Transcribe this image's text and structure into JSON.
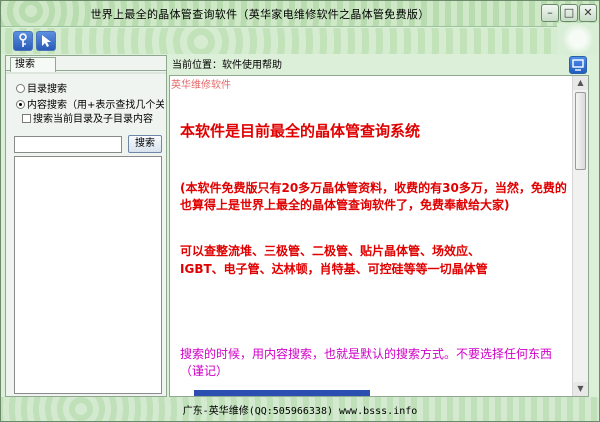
{
  "window": {
    "title": "世界上最全的晶体管查询软件（英华家电维修软件之晶体管免费版）"
  },
  "caption_buttons": {
    "minimize": "–",
    "maximize": "□",
    "close": "✕"
  },
  "toolbar": {
    "icons": [
      "key-icon",
      "arrow-cursor-icon"
    ]
  },
  "left_panel": {
    "tab_label": "搜索",
    "options": {
      "dir_search": "目录搜索",
      "content_search": "内容搜索（用+表示查找几个关键",
      "search_subdirs": "搜索当前目录及子目录内容"
    },
    "search_input_value": "",
    "search_button": "搜索"
  },
  "right_panel": {
    "location_label": "当前位置：",
    "location_value": "软件使用帮助",
    "watermark": "英华维修软件",
    "heading": "本软件是目前最全的晶体管查询系统",
    "para1": "(本软件免费版只有20多万晶体管资料，收费的有30多万，当然，免费的也算得上是世界上最全的晶体管查询软件了，免费奉献给大家)",
    "para2_line1": "可以查整流堆、三极管、二极管、贴片晶体管、场效应、",
    "para2_line2": "IGBT、电子管、达林顿，肖特基、可控硅等等一切晶体管",
    "para3": "搜索的时候，用内容搜索，也就是默认的搜索方式。不要选择任何东西（谨记）"
  },
  "status_bar": {
    "text": "广东-英华维修(QQ:505966338) www.bsss.info"
  }
}
